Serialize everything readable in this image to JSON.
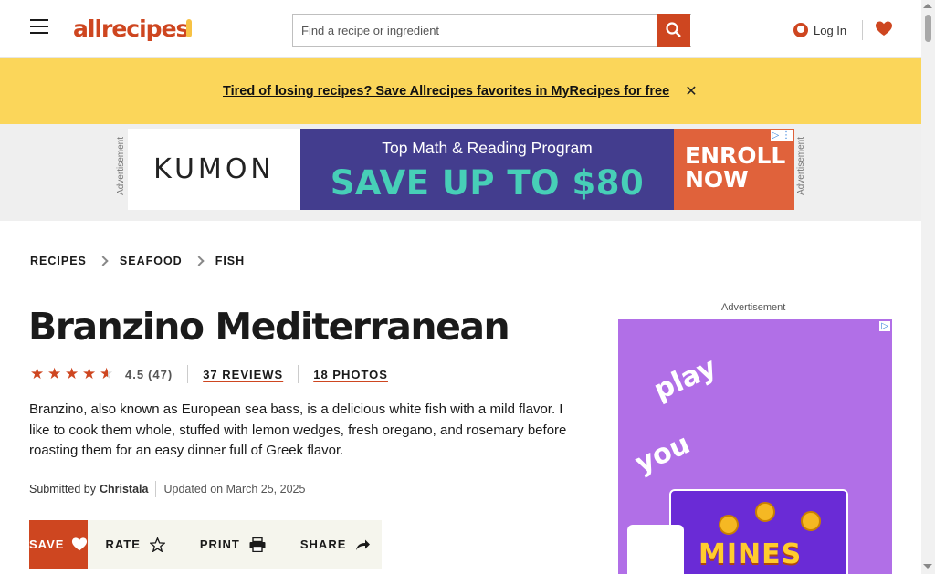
{
  "header": {
    "logo_text": "allrecipes",
    "search_placeholder": "Find a recipe or ingredient",
    "login_label": "Log In",
    "icons": {
      "menu": "hamburger-icon",
      "search": "search-icon",
      "account": "user-icon",
      "saved": "heart-icon"
    }
  },
  "banner": {
    "text": "Tired of losing recipes? Save Allrecipes favorites in MyRecipes for free",
    "close_icon": "close-icon"
  },
  "top_ad": {
    "side_label": "Advertisement",
    "brand": "KUMON",
    "tagline": "Top Math & Reading Program",
    "headline": "SAVE UP TO $80",
    "cta_line1": "ENROLL",
    "cta_line2": "NOW",
    "adchoices": "▷ ⋮"
  },
  "breadcrumbs": [
    "RECIPES",
    "SEAFOOD",
    "FISH"
  ],
  "recipe": {
    "title": "Branzino Mediterranean",
    "rating_value": 4.5,
    "rating_count": "(47)",
    "reviews_label": "37 REVIEWS",
    "photos_label": "18 PHOTOS",
    "description": "Branzino, also known as European sea bass, is a delicious white fish with a mild flavor. I like to cook them whole, stuffed with lemon wedges, fresh oregano, and rosemary before roasting them for an easy dinner full of Greek flavor.",
    "submitted_prefix": "Submitted by",
    "author": "Christala",
    "updated": "Updated on March 25, 2025"
  },
  "actions": {
    "save_label": "SAVE",
    "rate_label": "RATE",
    "print_label": "PRINT",
    "share_label": "SHARE"
  },
  "side_ad": {
    "label": "Advertisement",
    "word1": "play",
    "word2": "you",
    "game": "MINES"
  },
  "colors": {
    "brand": "#ce4620",
    "banner": "#fbd65a",
    "ad_purple": "#433d8e",
    "ad_teal": "#47cfb7"
  }
}
